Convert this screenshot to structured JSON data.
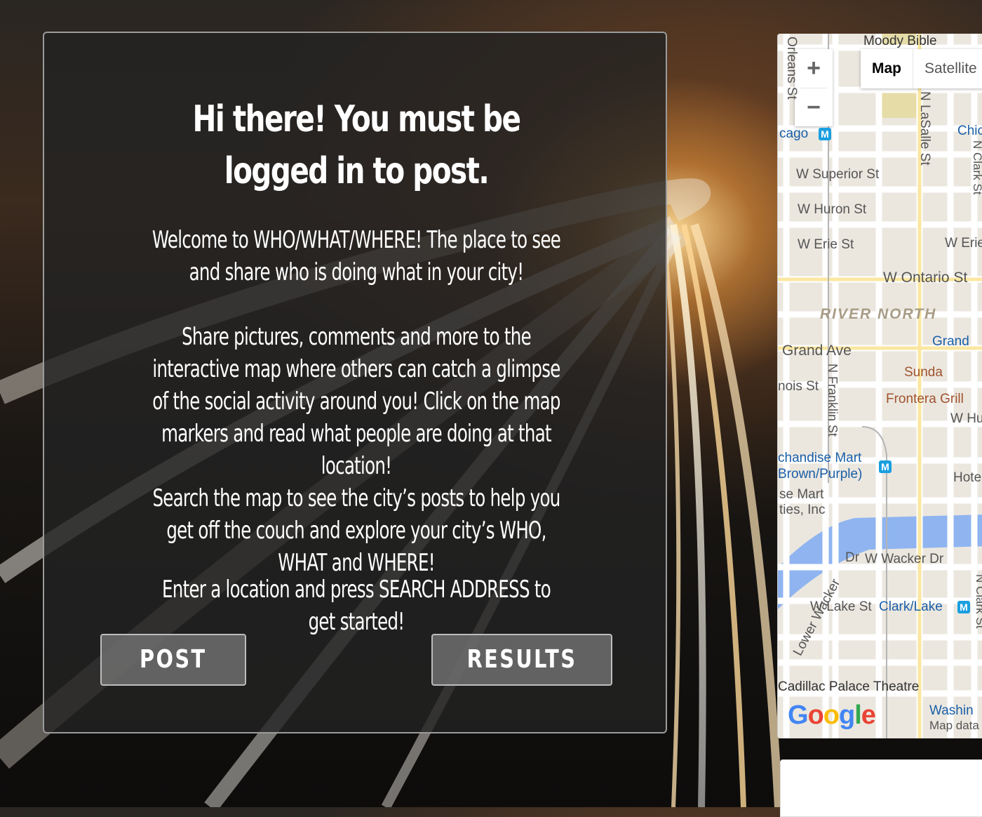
{
  "panel": {
    "title": "Hi there! You must be logged in to post.",
    "paragraphs": [
      "Welcome to WHO/WHAT/WHERE! The place to see and share who is doing what in your city!",
      "Share pictures, comments and more to the interactive map where others can catch a glimpse of the social activity around you! Click on the map markers and read what people are doing at that location!",
      "Search the map to see the city’s posts to help you get off the couch and explore your city’s WHO, WHAT and WHERE!",
      "Enter a location and press SEARCH ADDRESS to get started!"
    ],
    "buttons": {
      "post": "POST",
      "results": "RESULTS"
    }
  },
  "map": {
    "zoom_in": "+",
    "zoom_out": "−",
    "type_options": [
      "Map",
      "Satellite"
    ],
    "labels": {
      "moody": "Moody Bible",
      "orleans": "Orleans St",
      "chicago": "cago",
      "chi": "Chic",
      "lasalle": "N LaSalle St",
      "clark": "N Clark St",
      "superior": "W Superior St",
      "huron": "W Huron St",
      "erie": "W Erie St",
      "erie2": "W Erie",
      "ontario": "W Ontario St",
      "river_north": "RIVER NORTH",
      "grand_ave": "Grand Ave",
      "grand2": "Grand",
      "sunda": "Sunda",
      "illinois": "nois St",
      "franklin": "N Franklin St",
      "frontera": "Frontera Grill",
      "whu": "W Hu",
      "merch1": "chandise Mart",
      "merch2": "Brown/Purple)",
      "hotel": "Hote",
      "mart1": "se Mart",
      "mart2": "ties, Inc",
      "wacker_dr": "Dr",
      "w_wacker": "W Wacker Dr",
      "lower_wacker": "Lower Wacker",
      "lake": "W Lake St",
      "clark_lake": "Clark/Lake",
      "n_clark2": "N Clark St",
      "cadillac": "Cadillac Palace Theatre",
      "washington": "Washin",
      "map_data": "Map data"
    },
    "metro_symbol": "M",
    "logo": [
      "G",
      "o",
      "o",
      "g",
      "l",
      "e"
    ]
  }
}
